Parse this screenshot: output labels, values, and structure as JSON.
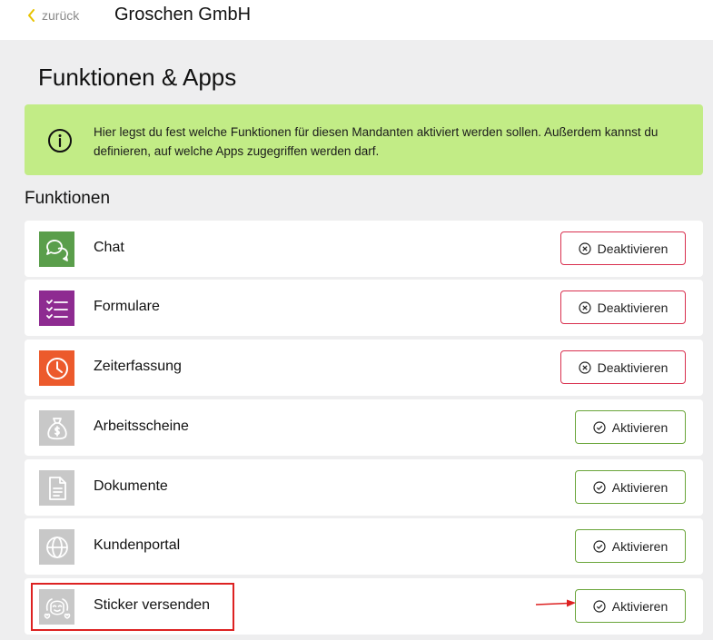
{
  "header": {
    "back_label": "zurück",
    "company": "Groschen GmbH"
  },
  "page": {
    "title": "Funktionen & Apps"
  },
  "info": {
    "text": "Hier legst du fest welche Funktionen für diesen Mandanten aktiviert werden sollen. Außerdem kannst du definieren, auf welche Apps zugegriffen werden darf."
  },
  "section": {
    "title": "Funktionen"
  },
  "colors": {
    "info_background": "#c2ec86",
    "deactivate_border": "#d9304f",
    "activate_border": "#6aa53a",
    "annotation_red": "#dd2222"
  },
  "features": [
    {
      "label": "Chat",
      "icon": "chat-bubbles-icon",
      "tile_color": "#5a9e4b",
      "active": true,
      "button": "Deaktivieren"
    },
    {
      "label": "Formulare",
      "icon": "checklist-icon",
      "tile_color": "#8e2b91",
      "active": true,
      "button": "Deaktivieren"
    },
    {
      "label": "Zeiterfassung",
      "icon": "clock-icon",
      "tile_color": "#ec5a2c",
      "active": true,
      "button": "Deaktivieren"
    },
    {
      "label": "Arbeitsscheine",
      "icon": "money-bag-icon",
      "tile_color": "#c8c8c8",
      "active": false,
      "button": "Aktivieren"
    },
    {
      "label": "Dokumente",
      "icon": "document-icon",
      "tile_color": "#c8c8c8",
      "active": false,
      "button": "Aktivieren"
    },
    {
      "label": "Kundenportal",
      "icon": "globe-icon",
      "tile_color": "#c8c8c8",
      "active": false,
      "button": "Aktivieren"
    },
    {
      "label": "Sticker versenden",
      "icon": "sticker-face-icon",
      "tile_color": "#c8c8c8",
      "active": false,
      "button": "Aktivieren"
    }
  ]
}
